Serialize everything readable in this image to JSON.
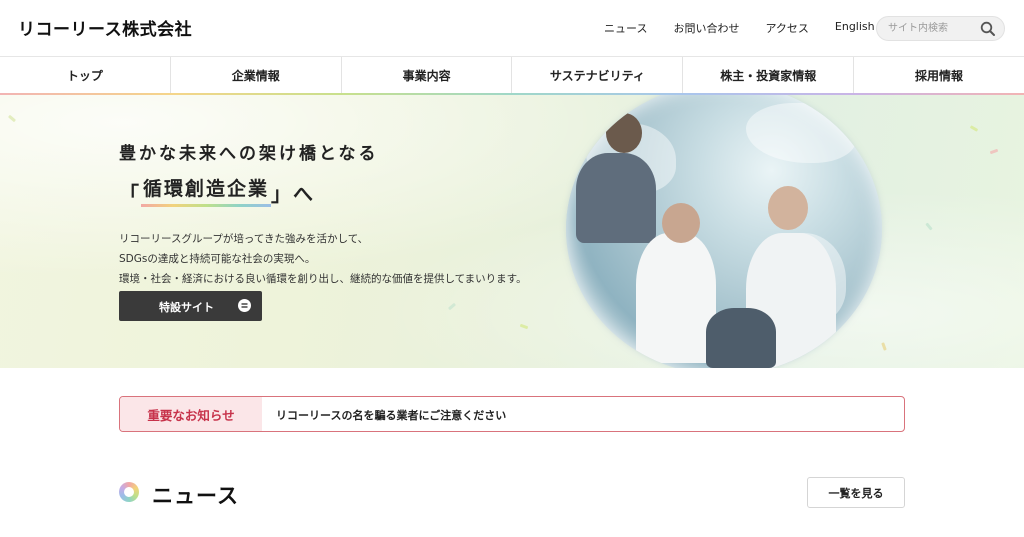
{
  "header": {
    "logo": "リコーリース株式会社",
    "util_nav": [
      "ニュース",
      "お問い合わせ",
      "アクセス",
      "English"
    ],
    "search_placeholder": "サイト内検索"
  },
  "gnav": [
    "トップ",
    "企業情報",
    "事業内容",
    "サステナビリティ",
    "株主・投資家情報",
    "採用情報"
  ],
  "hero": {
    "line1": "豊かな未来への架け橋となる",
    "line2_open": "「",
    "line2_keyword": "循環創造企業",
    "line2_close": "」へ",
    "desc": [
      "リコーリースグループが培ってきた強みを活かして、",
      "SDGsの達成と持続可能な社会の実現へ。",
      "環境・社会・経済における良い循環を創り出し、継続的な価値を提供してまいります。"
    ],
    "button": "特設サイト"
  },
  "notice": {
    "label": "重要なお知らせ",
    "text": "リコーリースの名を騙る業者にご注意ください"
  },
  "news": {
    "title": "ニュース",
    "more": "一覧を見る"
  },
  "colors": {
    "notice_accent": "#c7334b",
    "notice_border": "#d9737c",
    "button_dark": "#3a3a3a"
  }
}
